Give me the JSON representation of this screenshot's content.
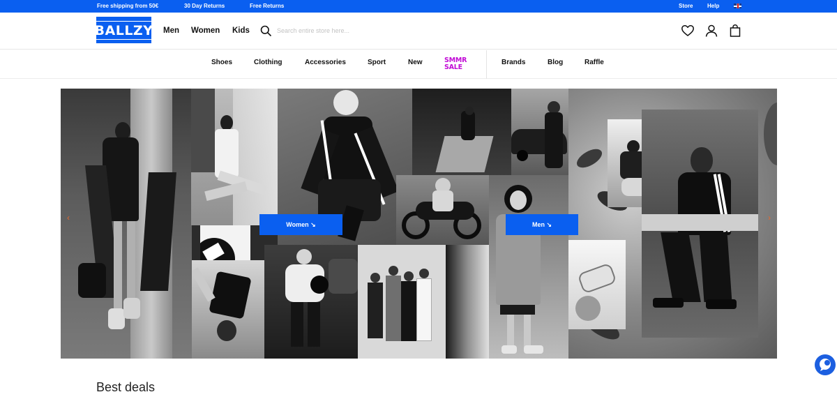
{
  "topbar": {
    "promos": [
      "Free shipping from 50€",
      "30 Day Returns",
      "Free Returns"
    ],
    "links": [
      "Store",
      "Help"
    ],
    "language_flag": "uk-flag-icon"
  },
  "header": {
    "logo_text": "BALLZY",
    "gender_nav": [
      "Men",
      "Women",
      "Kids"
    ],
    "search_placeholder": "Search entire store here...",
    "icons": [
      "heart-icon",
      "account-icon",
      "bag-icon"
    ]
  },
  "catnav": {
    "items": [
      "Shoes",
      "Clothing",
      "Accessories",
      "Sport",
      "New"
    ],
    "sale_lines": [
      "SMMR",
      "SALE"
    ],
    "secondary": [
      "Brands",
      "Blog",
      "Raffle"
    ]
  },
  "hero": {
    "women_button": "Women ↘",
    "men_button": "Men ↘",
    "prev_arrow": "‹",
    "next_arrow": "›"
  },
  "section": {
    "title": "Best deals"
  },
  "colors": {
    "brand_blue": "#0a5ff0",
    "sale_magenta": "#c10bd6",
    "arrow_orange": "#e8692d",
    "chat_blue": "#1c5fe0"
  }
}
